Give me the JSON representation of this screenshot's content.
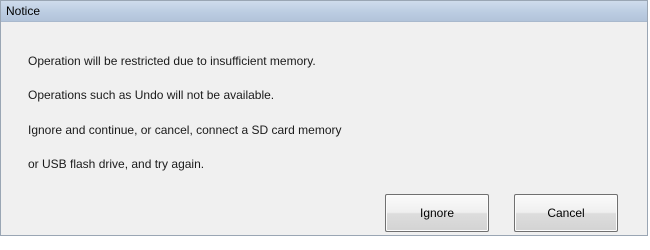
{
  "dialog": {
    "title": "Notice",
    "message_lines": [
      "Operation will be restricted due to insufficient memory.",
      "Operations such as Undo will not be available.",
      "Ignore and continue, or cancel, connect a SD card memory",
      "or USB flash drive, and try again."
    ],
    "buttons": {
      "ignore": "Ignore",
      "cancel": "Cancel"
    }
  }
}
